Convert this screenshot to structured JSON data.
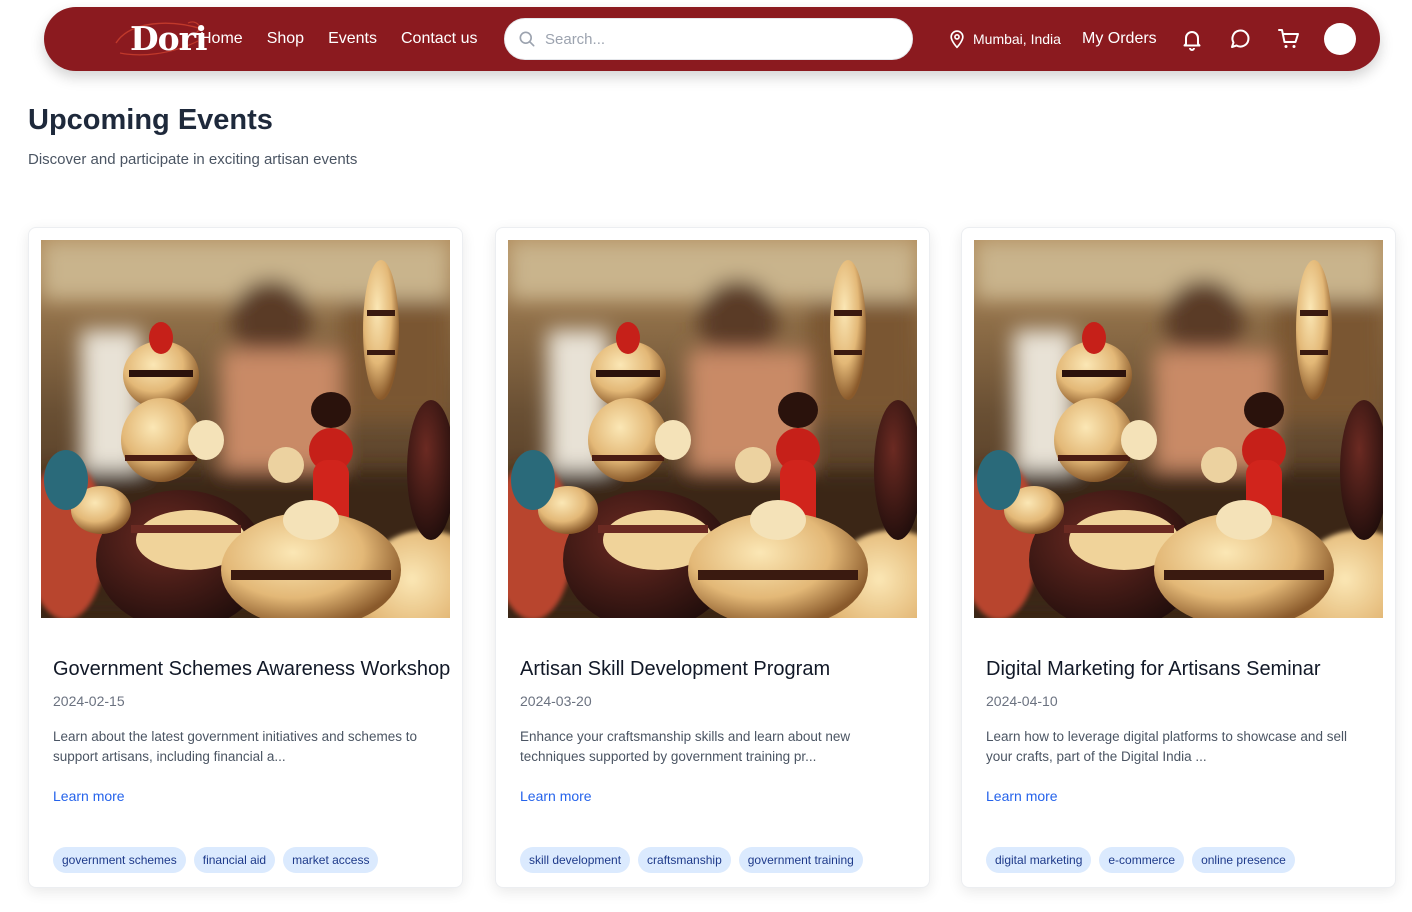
{
  "nav": {
    "logo": "Dori",
    "links": [
      "Home",
      "Shop",
      "Events",
      "Contact us"
    ],
    "search_placeholder": "Search...",
    "location": "Mumbai, India",
    "orders": "My Orders"
  },
  "page": {
    "title": "Upcoming Events",
    "subtitle": "Discover and participate in exciting artisan events"
  },
  "events": [
    {
      "title": "Government Schemes Awareness Workshop",
      "date": "2024-02-15",
      "description": "Learn about the latest government initiatives and schemes to support artisans, including financial a...",
      "link": "Learn more",
      "tags": [
        "government schemes",
        "financial aid",
        "market access"
      ]
    },
    {
      "title": "Artisan Skill Development Program",
      "date": "2024-03-20",
      "description": "Enhance your craftsmanship skills and learn about new techniques supported by government training pr...",
      "link": "Learn more",
      "tags": [
        "skill development",
        "craftsmanship",
        "government training"
      ]
    },
    {
      "title": "Digital Marketing for Artisans Seminar",
      "date": "2024-04-10",
      "description": "Learn how to leverage digital platforms to showcase and sell your crafts, part of the Digital India ...",
      "link": "Learn more",
      "tags": [
        "digital marketing",
        "e-commerce",
        "online presence"
      ]
    }
  ],
  "colors": {
    "brand": "#8b1a1f",
    "link": "#2563eb",
    "tag_bg": "#dbeafe",
    "tag_text": "#1e3a8a"
  },
  "icons": [
    "search-icon",
    "location-pin-icon",
    "bell-icon",
    "chat-icon",
    "cart-icon"
  ]
}
